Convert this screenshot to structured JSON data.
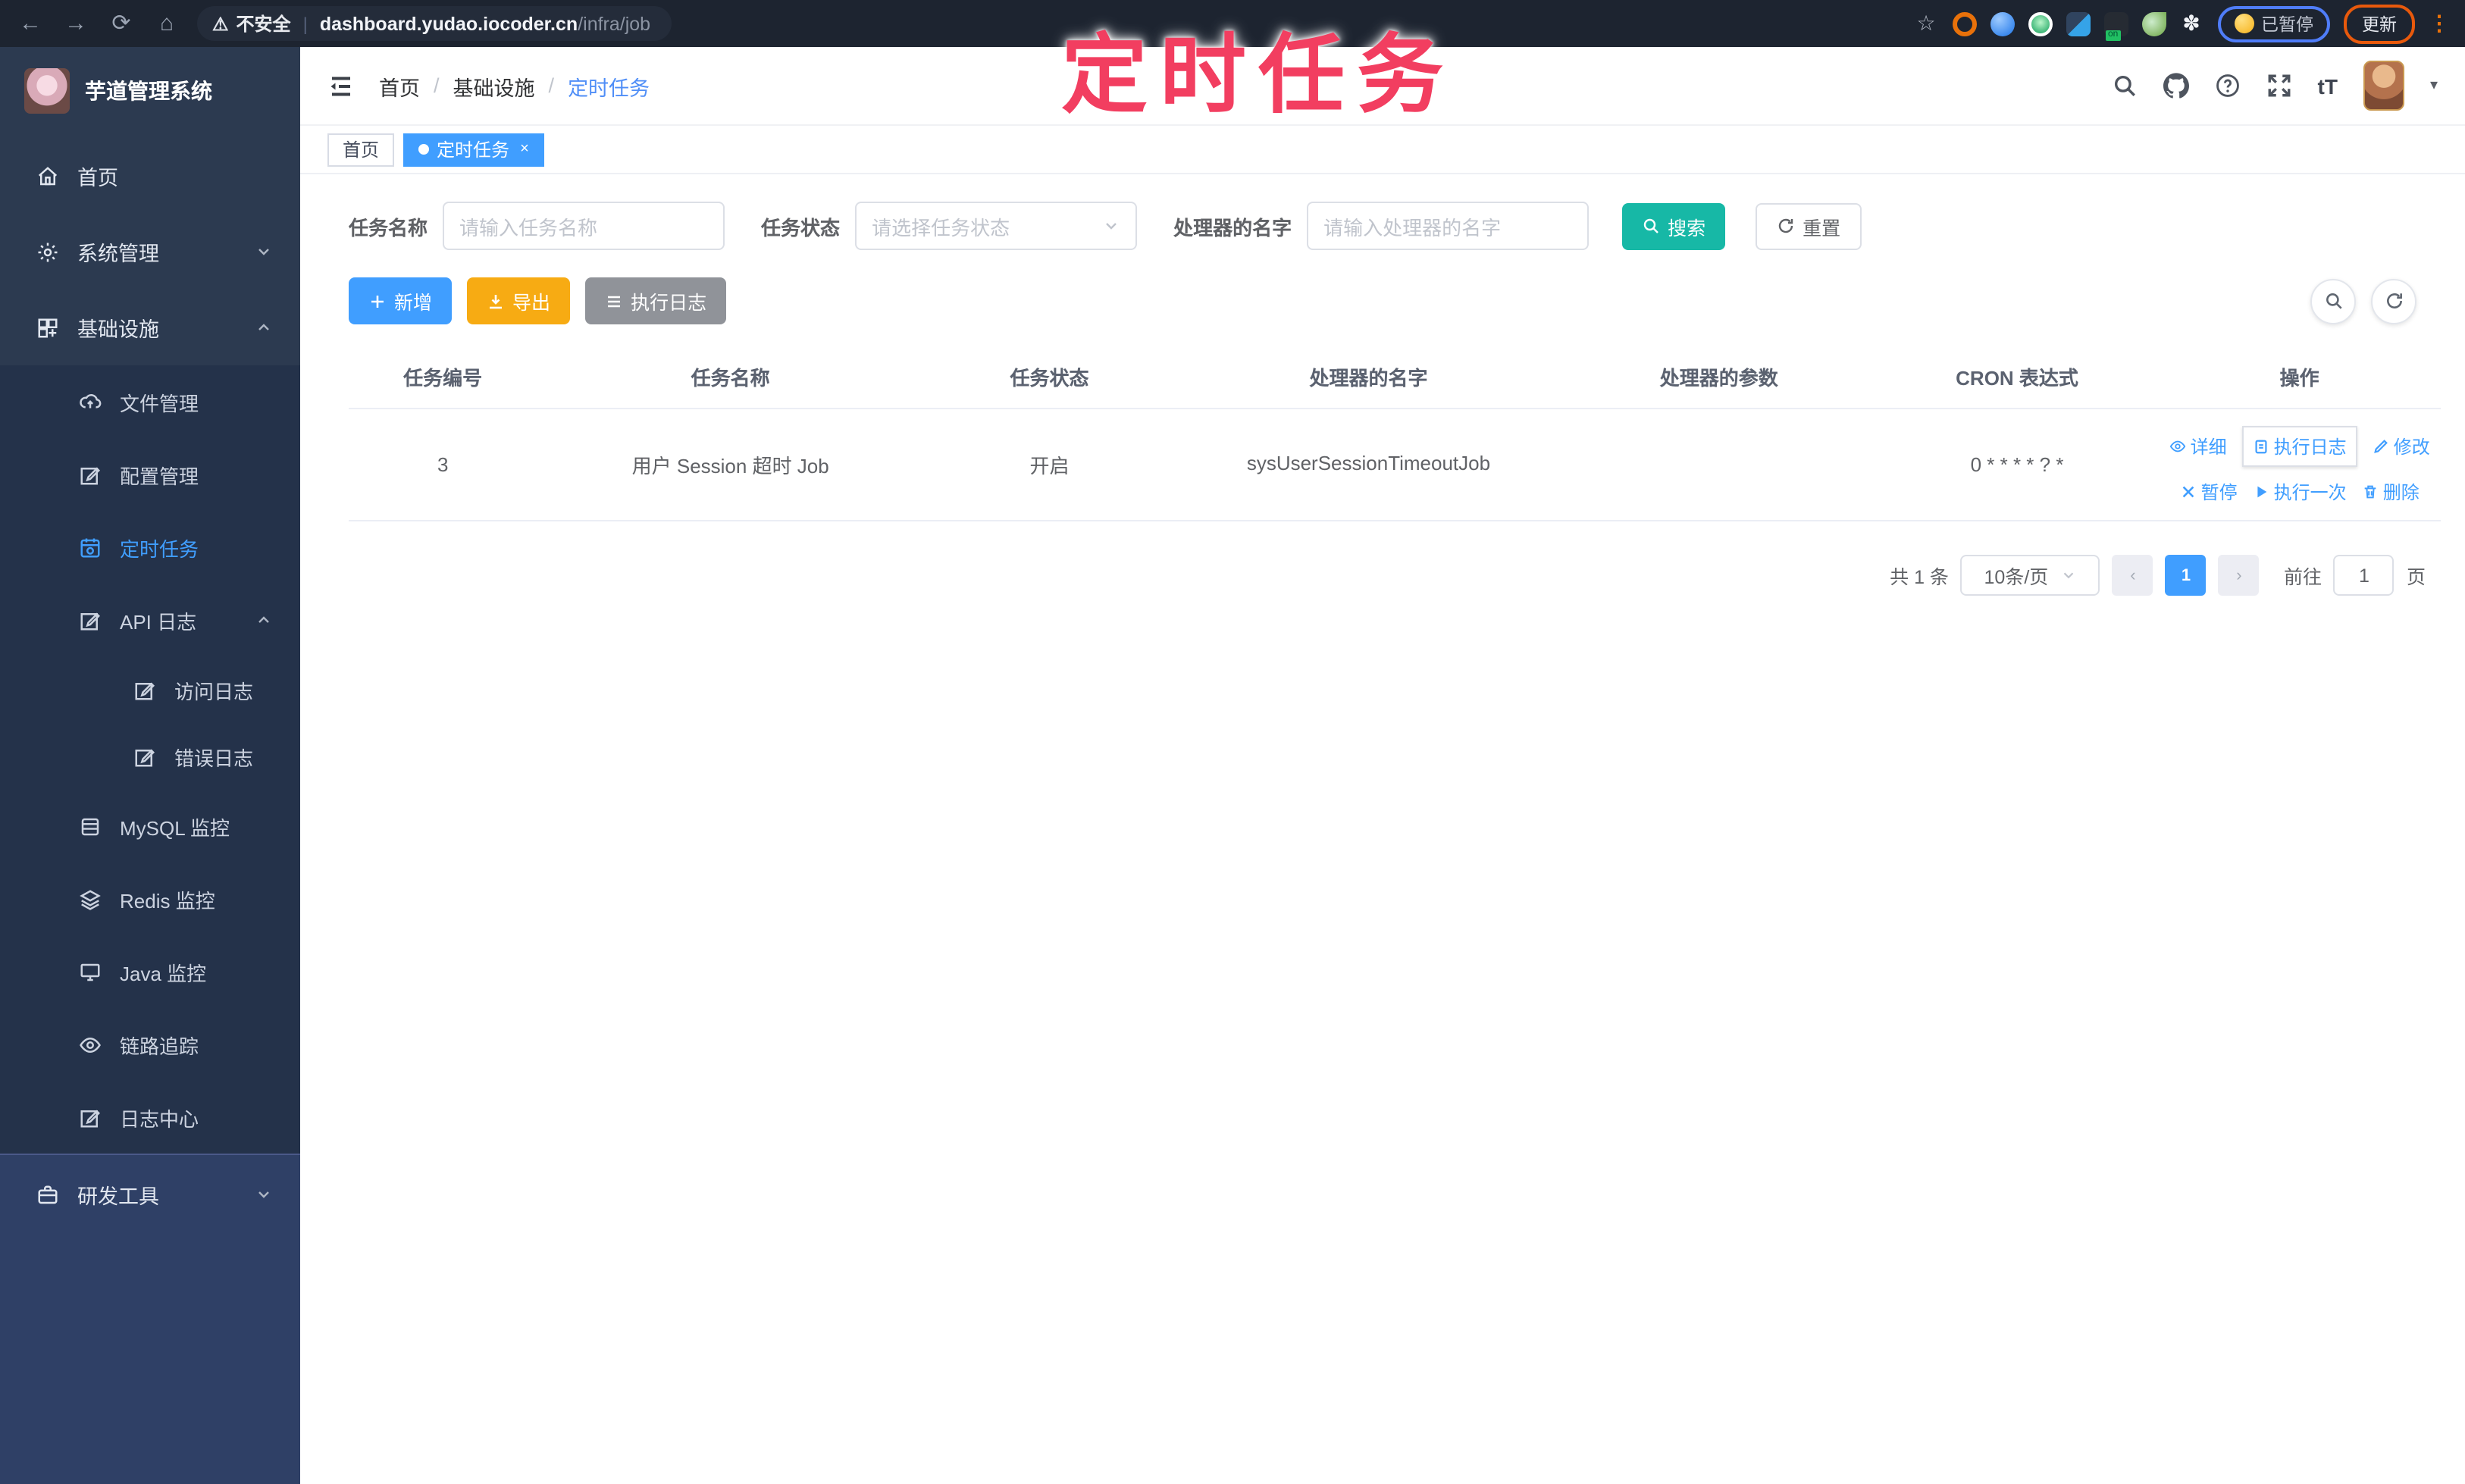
{
  "browser": {
    "security_label": "不安全",
    "url_host": "dashboard.yudao.iocoder.cn",
    "url_path": "/infra/job",
    "paused_badge": "已暂停",
    "update_button": "更新"
  },
  "annotation": {
    "text": "定时任务",
    "color": "#f23e60"
  },
  "sidebar": {
    "app_title": "芋道管理系统",
    "items": [
      {
        "label": "首页"
      },
      {
        "label": "系统管理"
      },
      {
        "label": "基础设施"
      },
      {
        "label": "文件管理"
      },
      {
        "label": "配置管理"
      },
      {
        "label": "定时任务"
      },
      {
        "label": "API 日志"
      },
      {
        "label": "访问日志"
      },
      {
        "label": "错误日志"
      },
      {
        "label": "MySQL 监控"
      },
      {
        "label": "Redis 监控"
      },
      {
        "label": "Java 监控"
      },
      {
        "label": "链路追踪"
      },
      {
        "label": "日志中心"
      },
      {
        "label": "研发工具"
      }
    ]
  },
  "header": {
    "breadcrumb": [
      "首页",
      "基础设施",
      "定时任务"
    ],
    "text_size_label": "tT"
  },
  "tabs": [
    {
      "label": "首页"
    },
    {
      "label": "定时任务",
      "close": "×"
    }
  ],
  "filters": {
    "task_name_label": "任务名称",
    "task_name_placeholder": "请输入任务名称",
    "task_status_label": "任务状态",
    "task_status_placeholder": "请选择任务状态",
    "handler_label": "处理器的名字",
    "handler_placeholder": "请输入处理器的名字",
    "search_label": "搜索",
    "reset_label": "重置"
  },
  "toolbar": {
    "add_label": "新增",
    "export_label": "导出",
    "exec_log_label": "执行日志"
  },
  "table": {
    "headers": [
      "任务编号",
      "任务名称",
      "任务状态",
      "处理器的名字",
      "处理器的参数",
      "CRON 表达式",
      "操作"
    ],
    "rows": [
      {
        "id": "3",
        "name": "用户 Session 超时 Job",
        "status": "开启",
        "handler": "sysUserSessionTimeoutJob",
        "params": "",
        "cron": "0 * * * * ? *"
      }
    ],
    "row_actions": [
      "详细",
      "执行日志",
      "修改",
      "暂停",
      "执行一次",
      "删除"
    ]
  },
  "pagination": {
    "total": "共 1 条",
    "page_size": "10条/页",
    "prev": "‹",
    "page": "1",
    "next": "›",
    "goto_label": "前往",
    "goto_value": "1",
    "page_unit": "页"
  },
  "icons": {
    "search-icon": "magnifier",
    "github-icon": "octocat",
    "help-icon": "question-circle",
    "fullscreen-icon": "expand-arrows",
    "refresh-icon": "circular-arrow",
    "warning-icon": "triangle-exclamation"
  },
  "colors": {
    "primary": "#409eff",
    "search_button": "#17b8a6",
    "export_button": "#f7ab13",
    "info_button": "#909399",
    "sidebar_bg": "#2c3a50",
    "annotation": "#f23e60"
  }
}
